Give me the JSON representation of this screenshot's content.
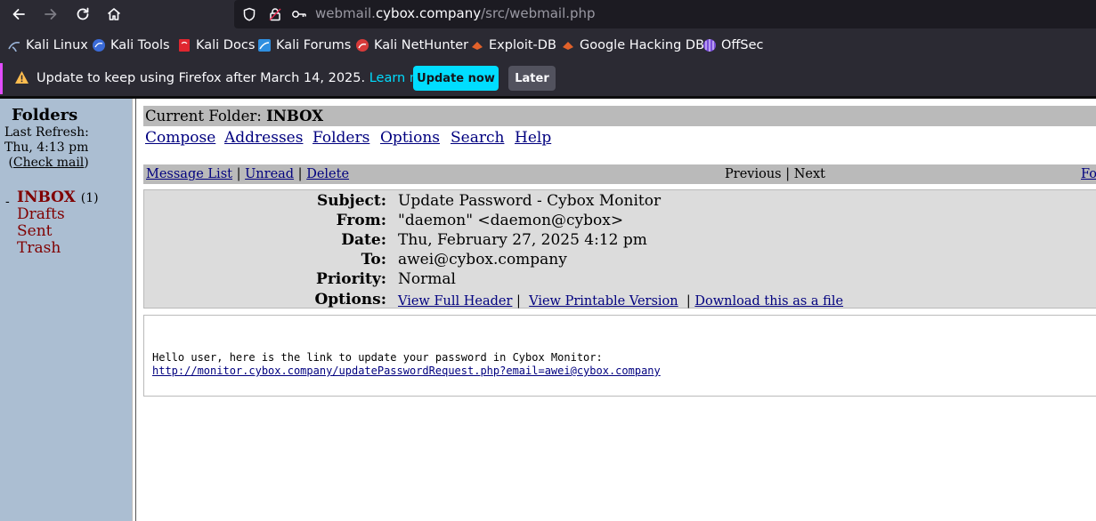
{
  "browser": {
    "url_prefix": "webmail.",
    "url_host": "cybox.company",
    "url_path": "/src/webmail.php",
    "icons": [
      "back-icon",
      "forward-icon",
      "reload-icon",
      "home-icon",
      "shield-icon",
      "lock-icon",
      "key-icon"
    ],
    "bookmarks": [
      {
        "label": "Kali Linux",
        "color": "#9ab4d8"
      },
      {
        "label": "Kali Tools",
        "color": "#3b6bd8"
      },
      {
        "label": "Kali Docs",
        "color": "#e0262f"
      },
      {
        "label": "Kali Forums",
        "color": "#2f8fe0"
      },
      {
        "label": "Kali NetHunter",
        "color": "#d83a3a"
      },
      {
        "label": "Exploit-DB",
        "color": "#e2612a"
      },
      {
        "label": "Google Hacking DB",
        "color": "#e2612a"
      },
      {
        "label": "OffSec",
        "color": "#7a4fd8"
      }
    ],
    "notice": {
      "text": "Update to keep using Firefox after March 14, 2025.",
      "learn_more": "Learn more",
      "update_now": "Update now",
      "later": "Later"
    }
  },
  "left": {
    "title": "Folders",
    "last_refresh_label": "Last Refresh:",
    "last_refresh_time": "Thu, 4:13 pm",
    "check_mail": "Check mail",
    "inbox": "INBOX",
    "inbox_count": "(1)",
    "folders": [
      "Drafts",
      "Sent",
      "Trash"
    ]
  },
  "main": {
    "current_folder_label": "Current Folder:",
    "current_folder": "INBOX",
    "menu": [
      "Compose",
      "Addresses",
      "Folders",
      "Options",
      "Search",
      "Help"
    ],
    "msgbar": {
      "message_list": "Message List",
      "unread": "Unread",
      "delete": "Delete",
      "previous": "Previous",
      "next": "Next",
      "forward_partial": "Fo"
    },
    "headers": {
      "subject_label": "Subject:",
      "subject": "Update Password - Cybox Monitor",
      "from_label": "From:",
      "from": "\"daemon\" <daemon@cybox>",
      "date_label": "Date:",
      "date": "Thu, February 27, 2025 4:12 pm",
      "to_label": "To:",
      "to": "awei@cybox.company",
      "priority_label": "Priority:",
      "priority": "Normal",
      "options_label": "Options:",
      "view_full_header": "View Full Header",
      "view_printable": "View Printable Version",
      "download": "Download this as a file"
    },
    "body": {
      "text": "Hello user, here is the link to update your password in Cybox Monitor:",
      "link": "http://monitor.cybox.company/updatePasswordRequest.php?email=awei@cybox.company"
    }
  }
}
